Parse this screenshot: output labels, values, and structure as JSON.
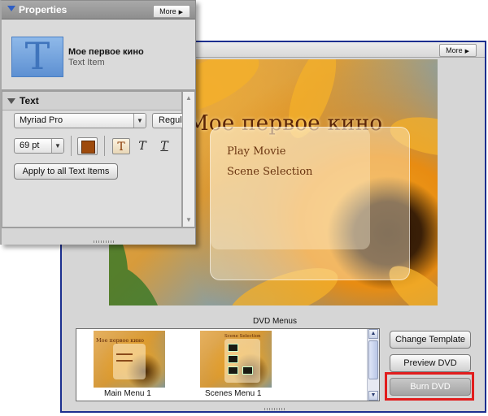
{
  "properties_panel": {
    "title": "Properties",
    "more_label": "More",
    "item": {
      "icon_letter": "T",
      "name": "Мое первое кино",
      "type": "Text Item"
    },
    "text_section": {
      "label": "Text",
      "font": "Myriad Pro",
      "style": "Regular",
      "size": "69 pt",
      "color": "#9e4a0c",
      "style_buttons": [
        "T",
        "T",
        "T"
      ],
      "apply_all_label": "Apply to all Text Items"
    }
  },
  "main_window": {
    "more_label": "More",
    "preview": {
      "title": "Мое первое кино",
      "menu_links": [
        "Play Movie",
        "Scene Selection"
      ]
    },
    "dvd_menus_label": "DVD Menus",
    "menus": [
      {
        "caption": "Main Menu 1",
        "thumb_title": "Мое первое кино"
      },
      {
        "caption": "Scenes Menu 1",
        "thumb_title": "Scene Selection"
      }
    ],
    "buttons": {
      "change_template": "Change Template",
      "preview_dvd": "Preview DVD",
      "burn_dvd": "Burn DVD"
    },
    "highlight_color": "#e11d1d"
  },
  "icons": {
    "more": "triangle-right-icon",
    "collapse": "triangle-down-icon",
    "scroll_up": "arrow-up-icon",
    "scroll_down": "arrow-down-icon"
  }
}
